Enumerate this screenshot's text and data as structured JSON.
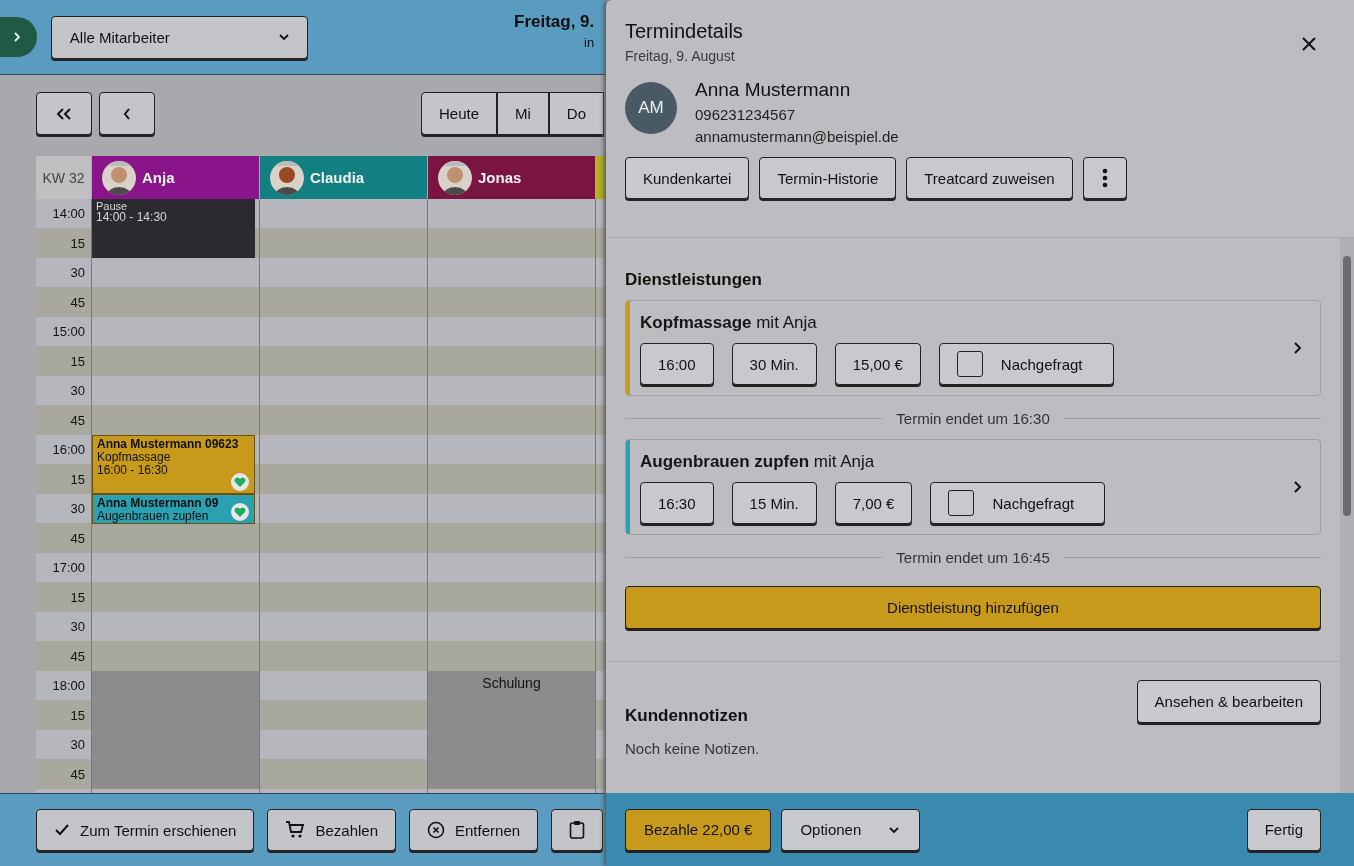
{
  "header": {
    "employee_filter": "Alle Mitarbeiter",
    "date_title": "Freitag, 9.",
    "date_subtitle": "in"
  },
  "nav": {
    "day_buttons": [
      {
        "label": "Heute"
      },
      {
        "label": "Mi"
      },
      {
        "label": "Do"
      }
    ]
  },
  "calendar": {
    "week_label": "KW 32",
    "employees": [
      {
        "name": "Anja",
        "color": "#8a148a"
      },
      {
        "name": "Claudia",
        "color": "#128080"
      },
      {
        "name": "Jonas",
        "color": "#7a1440"
      },
      {
        "color": "#b0b020"
      }
    ],
    "rows": [
      {
        "label": "14:00",
        "slots": [
          {
            "kind": "break",
            "event": {
              "title": "Pause",
              "time": "14:00 - 14:30"
            }
          },
          {
            "kind": "free"
          },
          {
            "kind": "free"
          },
          {
            "kind": "free"
          }
        ]
      },
      {
        "label": "15",
        "slots": [
          {
            "kind": "break"
          },
          {
            "kind": "free"
          },
          {
            "kind": "free"
          },
          {
            "kind": "free"
          }
        ]
      },
      {
        "label": "30",
        "slots": [
          {
            "kind": "free"
          },
          {
            "kind": "free"
          },
          {
            "kind": "free"
          },
          {
            "kind": "free"
          }
        ]
      },
      {
        "label": "45",
        "slots": [
          {
            "kind": "free"
          },
          {
            "kind": "free"
          },
          {
            "kind": "free"
          },
          {
            "kind": "free"
          }
        ]
      },
      {
        "label": "15:00",
        "slots": [
          {
            "kind": "free"
          },
          {
            "kind": "free"
          },
          {
            "kind": "free"
          },
          {
            "kind": "free"
          }
        ]
      },
      {
        "label": "15",
        "slots": [
          {
            "kind": "free"
          },
          {
            "kind": "free"
          },
          {
            "kind": "free"
          },
          {
            "kind": "free"
          }
        ]
      },
      {
        "label": "30",
        "slots": [
          {
            "kind": "free"
          },
          {
            "kind": "free"
          },
          {
            "kind": "free"
          },
          {
            "kind": "free"
          }
        ]
      },
      {
        "label": "45",
        "slots": [
          {
            "kind": "free"
          },
          {
            "kind": "free"
          },
          {
            "kind": "free"
          },
          {
            "kind": "free"
          }
        ]
      },
      {
        "label": "16:00",
        "slots": [
          {
            "kind": "appointment",
            "event": {
              "color": "#c89a1c",
              "title": "Anna Mustermann  09623",
              "service": "Kopfmassage",
              "time": "16:00 - 16:30"
            }
          },
          {
            "kind": "free"
          },
          {
            "kind": "free"
          },
          {
            "kind": "free"
          }
        ]
      },
      {
        "label": "15",
        "slots": [
          {
            "kind": "appointment"
          },
          {
            "kind": "free"
          },
          {
            "kind": "free"
          },
          {
            "kind": "free"
          }
        ]
      },
      {
        "label": "30",
        "slots": [
          {
            "kind": "appointment",
            "event": {
              "color": "#2aa0b0",
              "title": "Anna Mustermann  09",
              "service": "Augenbrauen zupfen"
            }
          },
          {
            "kind": "free"
          },
          {
            "kind": "free"
          },
          {
            "kind": "free"
          }
        ]
      },
      {
        "label": "45",
        "slots": [
          {
            "kind": "free"
          },
          {
            "kind": "free"
          },
          {
            "kind": "free"
          },
          {
            "kind": "free"
          }
        ]
      },
      {
        "label": "17:00",
        "slots": [
          {
            "kind": "free"
          },
          {
            "kind": "free"
          },
          {
            "kind": "free"
          },
          {
            "kind": "free"
          }
        ]
      },
      {
        "label": "15",
        "slots": [
          {
            "kind": "free"
          },
          {
            "kind": "free"
          },
          {
            "kind": "free"
          },
          {
            "kind": "free"
          }
        ]
      },
      {
        "label": "30",
        "slots": [
          {
            "kind": "free"
          },
          {
            "kind": "free"
          },
          {
            "kind": "free"
          },
          {
            "kind": "free"
          }
        ]
      },
      {
        "label": "45",
        "slots": [
          {
            "kind": "free"
          },
          {
            "kind": "free"
          },
          {
            "kind": "free"
          },
          {
            "kind": "free"
          }
        ]
      },
      {
        "label": "18:00",
        "slots": [
          {
            "kind": "blocked"
          },
          {
            "kind": "free"
          },
          {
            "kind": "blocked",
            "event": {
              "title": "Schulung"
            }
          },
          {
            "kind": "free"
          }
        ]
      },
      {
        "label": "15",
        "slots": [
          {
            "kind": "blocked"
          },
          {
            "kind": "free"
          },
          {
            "kind": "blocked"
          },
          {
            "kind": "free"
          }
        ]
      },
      {
        "label": "30",
        "slots": [
          {
            "kind": "blocked"
          },
          {
            "kind": "free"
          },
          {
            "kind": "blocked"
          },
          {
            "kind": "free"
          }
        ]
      },
      {
        "label": "45",
        "slots": [
          {
            "kind": "blocked"
          },
          {
            "kind": "free"
          },
          {
            "kind": "blocked"
          },
          {
            "kind": "free"
          }
        ]
      }
    ]
  },
  "bottom_actions": [
    {
      "kind": "check",
      "label": "Zum Termin erschienen"
    },
    {
      "kind": "cart",
      "label": "Bezahlen"
    },
    {
      "kind": "remove",
      "label": "Entfernen"
    },
    {
      "kind": "clipboard"
    }
  ],
  "panel": {
    "title": "Termindetails",
    "subtitle": "Freitag, 9. August",
    "customer": {
      "initials": "AM",
      "name": "Anna Mustermann",
      "phone": "096231234567",
      "email": "annamustermann@beispiel.de"
    },
    "actions": [
      "Kundenkartei",
      "Termin-Historie",
      "Treatcard zuweisen"
    ],
    "services": {
      "heading": "Dienstleistungen",
      "items": [
        {
          "title": "**Kopfmassage** mit Anja",
          "color": "#c89a1c",
          "time": "16:00",
          "duration": "30 Min.",
          "price": "15,00 €",
          "inquired_label": "Nachgefragt",
          "inquired": false,
          "end_note": "Termin endet um 16:30"
        },
        {
          "title": "**Augenbrauen zupfen** mit Anja",
          "color": "#2aa0b0",
          "time": "16:30",
          "duration": "15 Min.",
          "price": "7,00 €",
          "inquired_label": "Nachgefragt",
          "inquired": false,
          "end_note": "Termin endet um 16:45"
        }
      ]
    },
    "add_button": "Dienstleistung hinzufügen",
    "notes": {
      "heading": "Kundennotizen",
      "button": "Ansehen & bearbeiten",
      "empty_text": "Noch keine Notizen."
    },
    "footer": {
      "pay_button": "Bezahle 22,00 €",
      "options_button": "Optionen",
      "done_button": "Fertig"
    }
  }
}
